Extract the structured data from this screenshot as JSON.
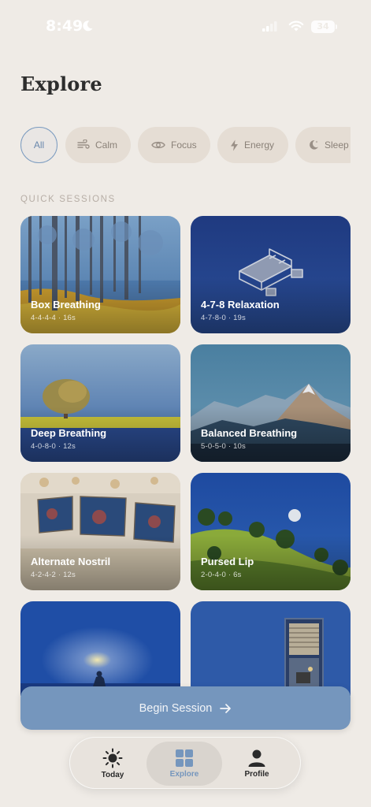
{
  "status_bar": {
    "time": "8:49",
    "battery": "34"
  },
  "header": {
    "title": "Explore"
  },
  "filters": [
    {
      "label": "All",
      "icon": "none",
      "selected": true
    },
    {
      "label": "Calm",
      "icon": "wind-icon",
      "selected": false
    },
    {
      "label": "Focus",
      "icon": "eye-icon",
      "selected": false
    },
    {
      "label": "Energy",
      "icon": "bolt-icon",
      "selected": false
    },
    {
      "label": "Sleep",
      "icon": "moon-icon",
      "selected": false
    }
  ],
  "section": {
    "label": "QUICK SESSIONS"
  },
  "sessions": [
    {
      "title": "Box Breathing",
      "meta": "4-4-4-4 · 16s"
    },
    {
      "title": "4-7-8 Relaxation",
      "meta": "4-7-8-0 · 19s"
    },
    {
      "title": "Deep Breathing",
      "meta": "4-0-8-0 · 12s"
    },
    {
      "title": "Balanced Breathing",
      "meta": "5-0-5-0 · 10s"
    },
    {
      "title": "Alternate Nostril",
      "meta": "4-2-4-2 · 12s"
    },
    {
      "title": "Pursed Lip",
      "meta": "2-0-4-0 · 6s"
    },
    {
      "title": "",
      "meta": ""
    },
    {
      "title": "",
      "meta": ""
    }
  ],
  "begin_button": {
    "label": "Begin Session"
  },
  "tabs": [
    {
      "label": "Today",
      "icon": "sun-icon"
    },
    {
      "label": "Explore",
      "icon": "grid-icon",
      "active": true
    },
    {
      "label": "Profile",
      "icon": "person-icon"
    }
  ],
  "colors": {
    "accent": "#7596bd",
    "background": "#efebe6",
    "chip": "#e5ddd4"
  }
}
